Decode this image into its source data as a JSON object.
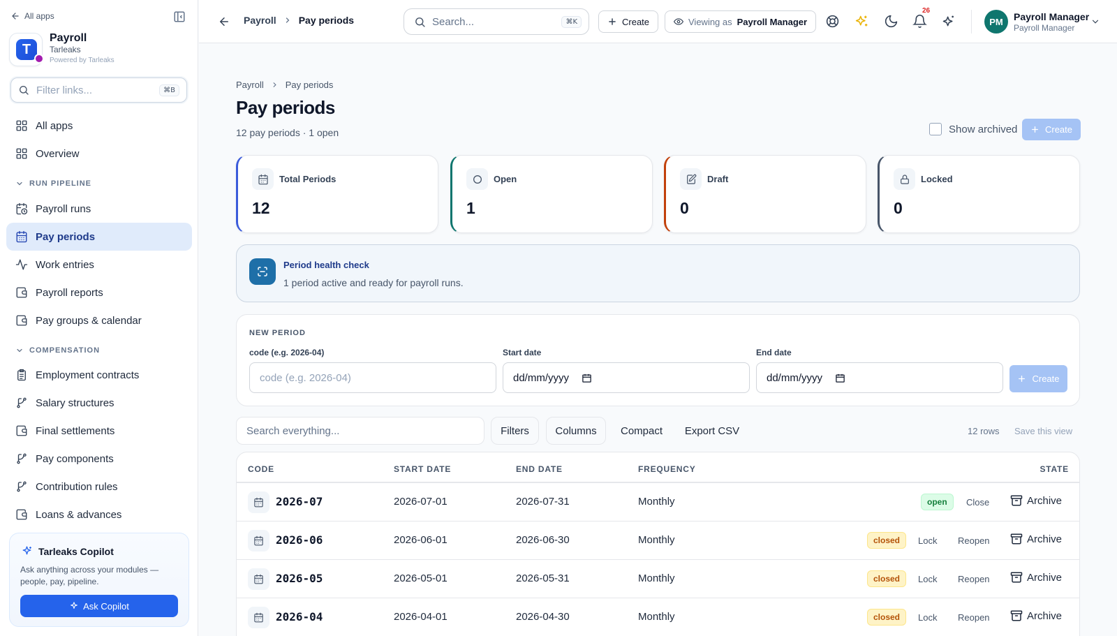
{
  "sidebar": {
    "back_label": "All apps",
    "app": {
      "name": "Payroll",
      "org": "Tarleaks",
      "powered": "Powered by Tarleaks",
      "logo_letter": "T"
    },
    "filter": {
      "placeholder": "Filter links...",
      "shortcut": "⌘B"
    },
    "top_items": [
      {
        "label": "All apps",
        "icon": "grid-icon"
      },
      {
        "label": "Overview",
        "icon": "grid-icon"
      }
    ],
    "sections": [
      {
        "label": "RUN PIPELINE",
        "items": [
          {
            "label": "Payroll runs",
            "icon": "calendar-clock-icon"
          },
          {
            "label": "Pay periods",
            "icon": "calendar-icon",
            "active": true
          },
          {
            "label": "Work entries",
            "icon": "activity-icon"
          },
          {
            "label": "Payroll reports",
            "icon": "wallet-icon"
          },
          {
            "label": "Pay groups & calendar",
            "icon": "wallet-icon"
          }
        ]
      },
      {
        "label": "COMPENSATION",
        "items": [
          {
            "label": "Employment contracts",
            "icon": "clipboard-icon"
          },
          {
            "label": "Salary structures",
            "icon": "branch-icon"
          },
          {
            "label": "Final settlements",
            "icon": "wallet-icon"
          },
          {
            "label": "Pay components",
            "icon": "branch-icon"
          },
          {
            "label": "Contribution rules",
            "icon": "branch-icon"
          },
          {
            "label": "Loans & advances",
            "icon": "wallet-icon"
          }
        ]
      }
    ],
    "copilot": {
      "title": "Tarleaks Copilot",
      "description": "Ask anything across your modules — people, pay, pipeline.",
      "button": "Ask Copilot"
    }
  },
  "topbar": {
    "breadcrumb": [
      "Payroll",
      "Pay periods"
    ],
    "search": {
      "placeholder": "Search...",
      "shortcut": "⌘K"
    },
    "create_label": "Create",
    "viewing_as": {
      "prefix": "Viewing as",
      "role": "Payroll Manager"
    },
    "notifications_count": "26",
    "user": {
      "initials": "PM",
      "name": "Payroll Manager",
      "role": "Payroll Manager"
    }
  },
  "page": {
    "breadcrumb": [
      "Payroll",
      "Pay periods"
    ],
    "title": "Pay periods",
    "subtitle": "12 pay periods · 1 open",
    "show_archived": "Show archived",
    "create_label": "Create"
  },
  "stats": [
    {
      "label": "Total Periods",
      "value": "12",
      "icon": "calendar-icon",
      "accent": "#3b5bdb"
    },
    {
      "label": "Open",
      "value": "1",
      "icon": "circle-icon",
      "accent": "#0f766e"
    },
    {
      "label": "Draft",
      "value": "0",
      "icon": "edit-icon",
      "accent": "#c2410c"
    },
    {
      "label": "Locked",
      "value": "0",
      "icon": "lock-icon",
      "accent": "#475569"
    }
  ],
  "health": {
    "title": "Period health check",
    "description": "1 period active and ready for payroll runs."
  },
  "new_period": {
    "section_label": "NEW PERIOD",
    "code_label": "code (e.g. 2026-04)",
    "code_placeholder": "code (e.g. 2026-04)",
    "start_label": "Start date",
    "end_label": "End date",
    "date_placeholder": "dd/mm/yyyy",
    "create_label": "Create"
  },
  "toolbar": {
    "search_placeholder": "Search everything...",
    "filters": "Filters",
    "columns": "Columns",
    "compact": "Compact",
    "export": "Export CSV",
    "rows_count": "12 rows",
    "save_view": "Save this view"
  },
  "table": {
    "headers": [
      "CODE",
      "START DATE",
      "END DATE",
      "FREQUENCY",
      "STATE"
    ],
    "rows": [
      {
        "code": "2026-07",
        "start": "2026-07-01",
        "end": "2026-07-31",
        "frequency": "Monthly",
        "state": "open",
        "actions": [
          "Close"
        ],
        "archive": "Archive"
      },
      {
        "code": "2026-06",
        "start": "2026-06-01",
        "end": "2026-06-30",
        "frequency": "Monthly",
        "state": "closed",
        "actions": [
          "Lock",
          "Reopen"
        ],
        "archive": "Archive"
      },
      {
        "code": "2026-05",
        "start": "2026-05-01",
        "end": "2026-05-31",
        "frequency": "Monthly",
        "state": "closed",
        "actions": [
          "Lock",
          "Reopen"
        ],
        "archive": "Archive"
      },
      {
        "code": "2026-04",
        "start": "2026-04-01",
        "end": "2026-04-30",
        "frequency": "Monthly",
        "state": "closed",
        "actions": [
          "Lock",
          "Reopen"
        ],
        "archive": "Archive"
      }
    ]
  }
}
